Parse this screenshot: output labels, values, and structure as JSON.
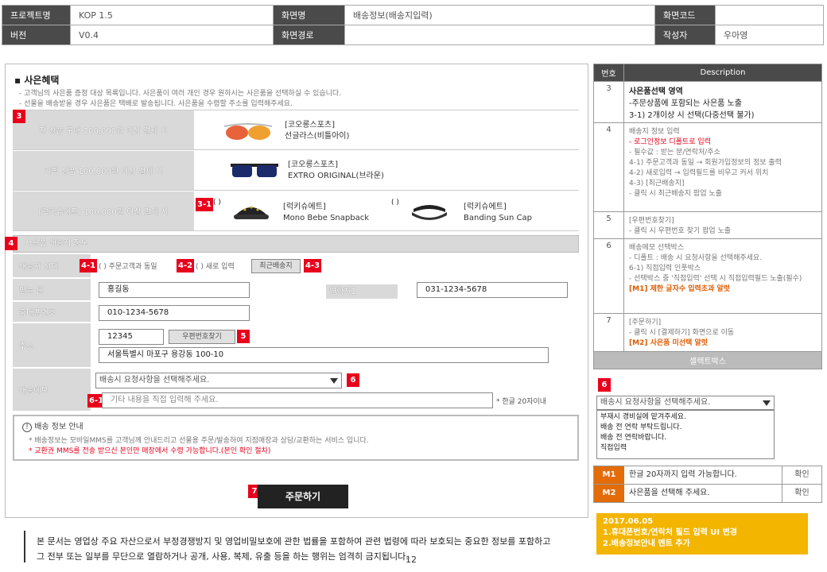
{
  "header": {
    "project_label": "프로젝트명",
    "project_value": "KOP 1.5",
    "screen_label": "화면명",
    "screen_value": "배송정보(배송지입력)",
    "code_label": "화면코드",
    "code_value": "",
    "version_label": "버전",
    "version_value": "V0.4",
    "path_label": "화면경로",
    "path_value": "",
    "author_label": "작성자",
    "author_value": "우아영"
  },
  "gift": {
    "title": "사은혜택",
    "note1": "- 고객님의 사은품 증정 대상 목록입니다. 사은품이 여러 개인 경우 원하시는 사은품을 선택하실 수 있습니다.",
    "note2": "- 선물을 배송받을 경우 사은품은 택배로 발송됩니다. 사은품을 수령할 주소를 입력해주세요.",
    "rows": [
      {
        "condition": "전 상품 구매 100,000원 이상 결제 시",
        "brand": "[코오롱스포츠]",
        "name": "선글라스(비틀아이)"
      },
      {
        "condition": "기획 상품 100,000원 이상 결제 시",
        "brand": "[코오롱스포츠]",
        "name": "EXTRO ORIGINAL(브라운)"
      },
      {
        "condition": "[럭키슈에트] 100,000원 이상 결제 시",
        "brand": "[럭키슈에트]",
        "name": "Mono Bebe Snapback",
        "brand2": "[럭키슈에트]",
        "name2": "Banding Sun Cap"
      }
    ],
    "radio_mark": "( )"
  },
  "shipping": {
    "section_title": "사은품 배송지 정보",
    "option_label": "배송지 선택",
    "option1": "주문고객과 동일",
    "option2": "새로 입력",
    "recent_button": "최근배송지",
    "recipient_label": "받는 분",
    "recipient_value": "홍길동",
    "phone_label": "연락처1",
    "phone_value": "031-1234-5678",
    "mobile_label": "휴대폰번호",
    "mobile_value": "010-1234-5678",
    "address_label": "주소",
    "zip_value": "12345",
    "zip_button": "우편번호찾기",
    "address_value": "서울특별시 마포구 용강동 100-10",
    "memo_label": "배송메모",
    "memo_select": "배송시 요청사항을 선택해주세요.",
    "memo_placeholder": "기타 내용을 직접 입력해 주세요.",
    "memo_limit": "* 한글 20자이내"
  },
  "info": {
    "title": "배송 정보 안내",
    "line1": "* 배송정보는 모바일MMS를 고객님께 안내드리고 선물용 주문/발송하여 지점매장과 상담/교환하는 서비스 입니다.",
    "line2": "* 교환권 MMS를 전송 받으신 본인만 매장에서 수령 가능합니다.(본인 확인 절차)"
  },
  "order_button": "주문하기",
  "markers": {
    "m3": "3",
    "m3_1": "3-1",
    "m4": "4",
    "m4_1": "4-1",
    "m4_2": "4-2",
    "m4_3": "4-3",
    "m5": "5",
    "m6": "6",
    "m6_1": "6-1",
    "m7": "7",
    "m6_right": "6"
  },
  "desc": {
    "col_no": "번호",
    "col_desc": "Description",
    "items": [
      {
        "no": "3",
        "title": "사은품선택 영역",
        "lines": [
          "-주문상품에 포함되는 사은품 노출",
          "3-1) 2개이상 시 선택(다중선택 불가)"
        ]
      },
      {
        "no": "4",
        "title": "배송지 정보 입력",
        "red": "- 로그인정보 디폴트로 입력",
        "lines": [
          "- 필수값 : 받는 분/연락처/주소",
          "4-1) 주문고객과 동일 → 회원가입정보의 정보 출력",
          "4-2) 새로입력 → 입력필드를 비우고 커서 위치",
          "4-3) [최근배송지]",
          "- 클릭 시 최근배송지 팝업 노출"
        ]
      },
      {
        "no": "5",
        "title": "[우편번호찾기]",
        "lines": [
          "- 클릭 시 우편번호 찾기 팝업 노출"
        ]
      },
      {
        "no": "6",
        "title": "배송메모 선택박스",
        "lines": [
          "- 디폴트 : 배송 시 요청사항을 선택해주세요.",
          "6-1) 직접입력 인풋박스",
          "- 선택박스 중 '직접입력' 선택 시 직접입력필드 노출(필수)"
        ],
        "orange": "[M1] 제한 글자수 입력초과 알럿"
      },
      {
        "no": "7",
        "title": "[주문하기]",
        "lines": [
          "- 클릭 시 [결제하기] 화면으로 이동"
        ],
        "orange": "[M2] 사은품 미선택 알럿"
      }
    ],
    "options_header": "셀렉트박스",
    "select_value": "배송시 요청사항을 선택해주세요.",
    "options": [
      "부재시 경비실에 맡겨주세요.",
      "배송 전 연락 부탁드립니다.",
      "배송 전 연락바랍니다.",
      "직접입력"
    ],
    "messages": [
      {
        "key": "M1",
        "text": "한글 20자까지 입력 가능합니다.",
        "confirm": "확인"
      },
      {
        "key": "M2",
        "text": "사은품을 선택해 주세요.",
        "confirm": "확인"
      }
    ]
  },
  "footer": {
    "line1": "본 문서는 영업상 주요 자산으로서 부정경쟁방지 및 영업비밀보호에 관한 법률을 포함하여 관련 법령에 따라 보호되는 중요한 정보를 포함하고",
    "line2": "그 전부 또는 일부를 무단으로 열람하거나 공개, 사용, 복제, 유출 등을 하는 행위는 엄격히 금지됩니다.",
    "page": "12",
    "history_title": "2017.06.05",
    "history_line1": "1.휴대폰번호/연락처 필드 입력 UI 변경",
    "history_line2": "2.배송정보안내 멘트 추가"
  }
}
